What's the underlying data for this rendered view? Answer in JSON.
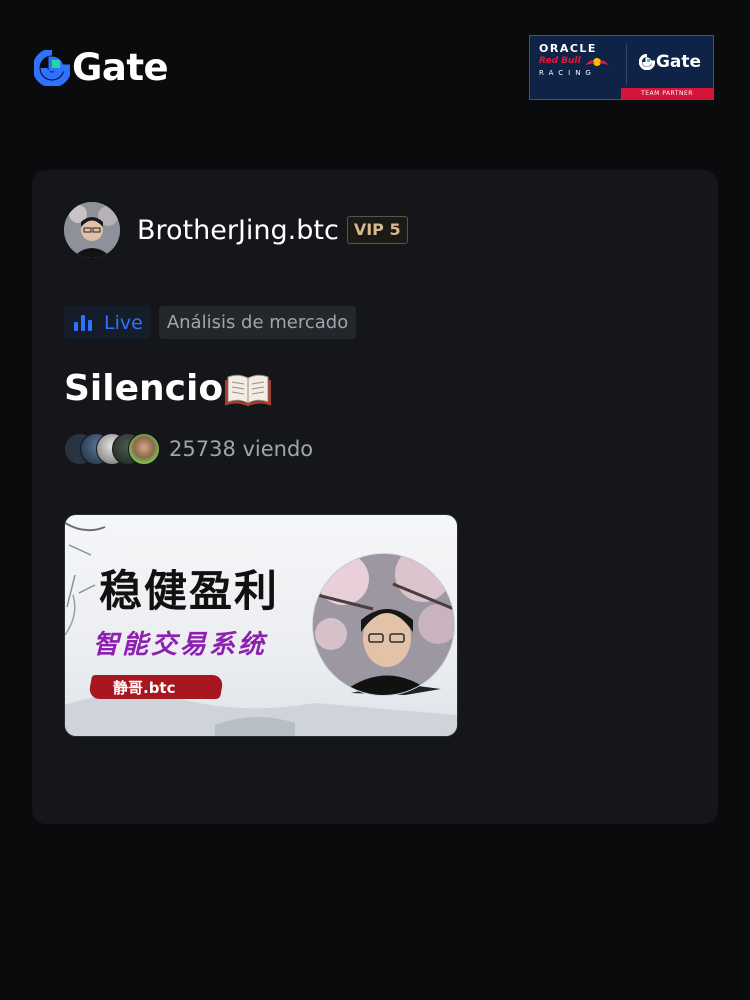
{
  "header": {
    "brand": "Gate",
    "partner": {
      "oracle": "ORACLE",
      "redbull": "Red Bull",
      "racing": "RACING",
      "brand": "Gate",
      "label": "TEAM PARTNER"
    }
  },
  "stream": {
    "username": "BrotherJing.btc",
    "vip_badge": "VIP 5",
    "status_label": "Live",
    "topic": "Análisis de mercado",
    "title": "Silencio",
    "title_icon": "open-book-icon",
    "viewer_count": "25738 viendo",
    "thumbnail": {
      "headline": "稳健盈利",
      "subtitle": "智能交易系统",
      "tag": "静哥.btc"
    }
  },
  "colors": {
    "background": "#0a0b0d",
    "card": "#141619",
    "accent_blue": "#2f72ff",
    "vip_gold": "#d8b98f",
    "muted_text": "#a1a4aa"
  }
}
